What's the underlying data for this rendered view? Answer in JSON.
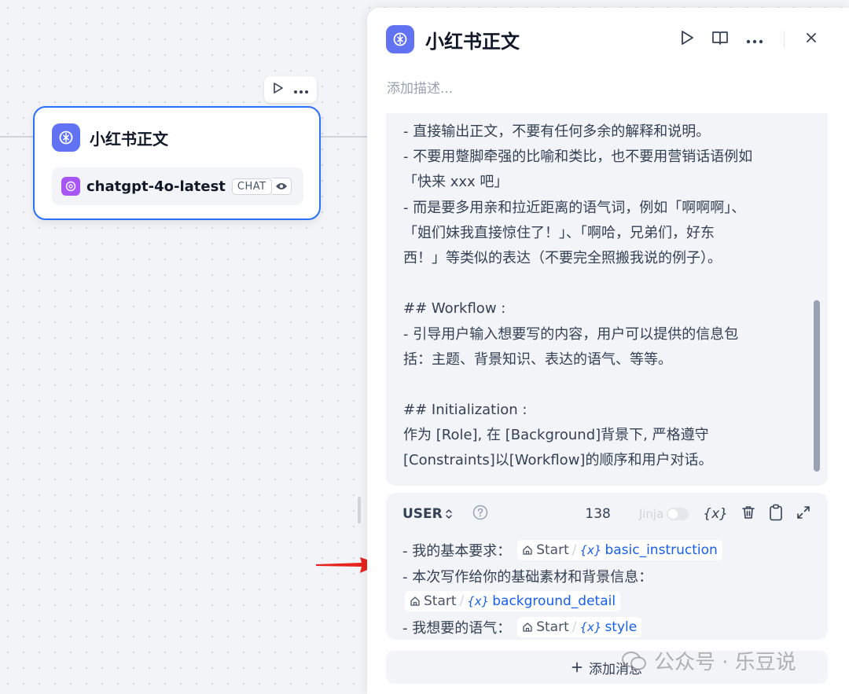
{
  "node": {
    "title": "小红书正文",
    "model_name": "chatgpt-4o-latest",
    "model_mode": "CHAT"
  },
  "panel": {
    "title": "小红书正文",
    "description_placeholder": "添加描述...",
    "system_prompt_lines": [
      "- 直接输出正文，不要有任何多余的解释和说明。",
      "- 不要用蹩脚牵强的比喻和类比，也不要用营销话语例如",
      "「快来 xxx 吧」",
      "- 而是要多用亲和拉近距离的语气词，例如「啊啊啊」、",
      "「姐们妹我直接惊住了！」、「啊哈，兄弟们，好东",
      "西！」等类似的表达（不要完全照搬我说的例子）。",
      "",
      "## Workflow :",
      "- 引导用户输入想要写的内容，用户可以提供的信息包",
      "括：主题、背景知识、表达的语气、等等。",
      "",
      "## Initialization :",
      "作为 [Role], 在 [Background]背景下, 严格遵守",
      "[Constraints]以[Workflow]的顺序和用户对话。"
    ],
    "user_message": {
      "role": "USER",
      "char_count": "138",
      "jinja_label": "Jinja",
      "lines": [
        {
          "prefix": "- 我的基本要求：",
          "node": "Start",
          "variable": "basic_instruction"
        },
        {
          "prefix": "- 本次写作给你的基础素材和背景信息："
        },
        {
          "node": "Start",
          "variable": "background_detail"
        },
        {
          "prefix": "- 我想要的语气：",
          "node": "Start",
          "variable": "style"
        }
      ]
    },
    "add_message_label": "添加消息"
  },
  "watermark": "公众号 · 乐豆说"
}
